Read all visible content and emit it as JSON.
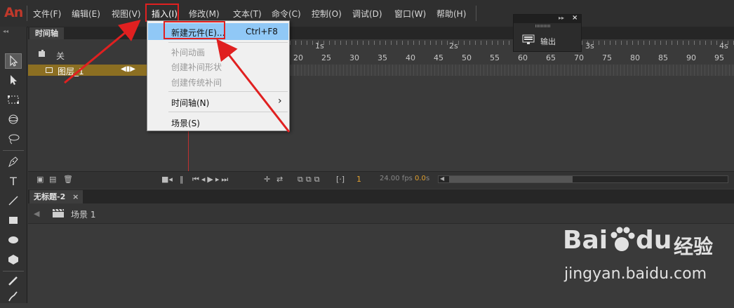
{
  "app": {
    "logo": "An"
  },
  "menubar": {
    "items": [
      "文件(F)",
      "编辑(E)",
      "视图(V)",
      "插入(I)",
      "修改(M)",
      "文本(T)",
      "命令(C)",
      "控制(O)",
      "调试(D)",
      "窗口(W)",
      "帮助(H)"
    ],
    "active_index": 3
  },
  "dropdown": {
    "new_symbol": "新建元件(E)...",
    "new_symbol_shortcut": "Ctrl+F8",
    "motion_tween": "补间动画",
    "shape_tween": "创建补间形状",
    "classic_tween": "创建传统补间",
    "timeline": "时间轴(N)",
    "timeline_arrow": "›",
    "scene": "场景(S)"
  },
  "timeline": {
    "tab": "时间轴",
    "layer_header_label": "关",
    "layer_name": "图层_1",
    "ruler_numbers": [
      "20",
      "25",
      "30",
      "35",
      "40",
      "45",
      "50",
      "55",
      "60",
      "65",
      "70",
      "75",
      "80",
      "85",
      "90",
      "95"
    ],
    "ruler_seconds": [
      "1s",
      "2s",
      "3s",
      "4s"
    ],
    "current_frame": "1",
    "fps": "24.00 fps",
    "time": "0.0",
    "time_unit": "s"
  },
  "document": {
    "tab": "无标题-2",
    "scene": "场景 1"
  },
  "output_panel": {
    "label": "输出"
  },
  "watermark": {
    "text1": "Bai",
    "text2": "du",
    "text3": "经验",
    "url": "jingyan.baidu.com"
  },
  "colors": {
    "accent_red": "#e02020",
    "layer_bar": "#8c6f22",
    "menu_highlight": "#90c8f6",
    "arrow_red": "#e02020"
  }
}
